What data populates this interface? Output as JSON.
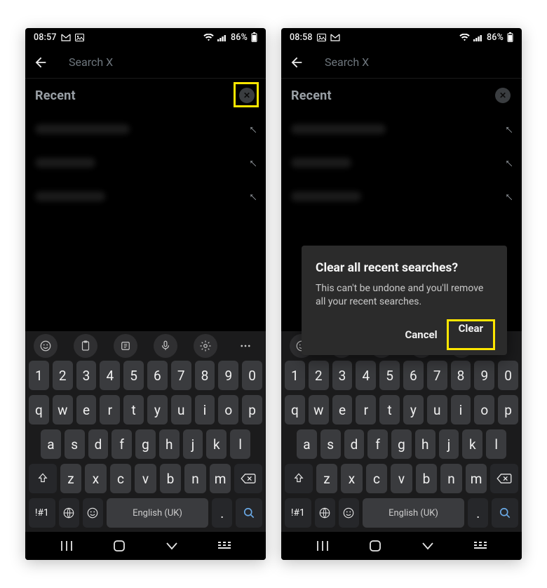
{
  "status": {
    "time": "08:57",
    "time2": "08:58",
    "battery": "86%"
  },
  "search": {
    "placeholder": "Search X"
  },
  "recent": {
    "title": "Recent"
  },
  "dialog": {
    "title": "Clear all recent searches?",
    "body": "This can't be undone and you'll remove all your recent searches.",
    "cancel": "Cancel",
    "clear": "Clear"
  },
  "keyboard": {
    "row1": [
      "1",
      "2",
      "3",
      "4",
      "5",
      "6",
      "7",
      "8",
      "9",
      "0"
    ],
    "row2": [
      "q",
      "w",
      "e",
      "r",
      "t",
      "y",
      "u",
      "i",
      "o",
      "p"
    ],
    "row3": [
      "a",
      "s",
      "d",
      "f",
      "g",
      "h",
      "j",
      "k",
      "l"
    ],
    "row4": [
      "z",
      "x",
      "c",
      "v",
      "b",
      "n",
      "m"
    ],
    "sym": "!#1",
    "lang": "English (UK)",
    "period": "."
  }
}
